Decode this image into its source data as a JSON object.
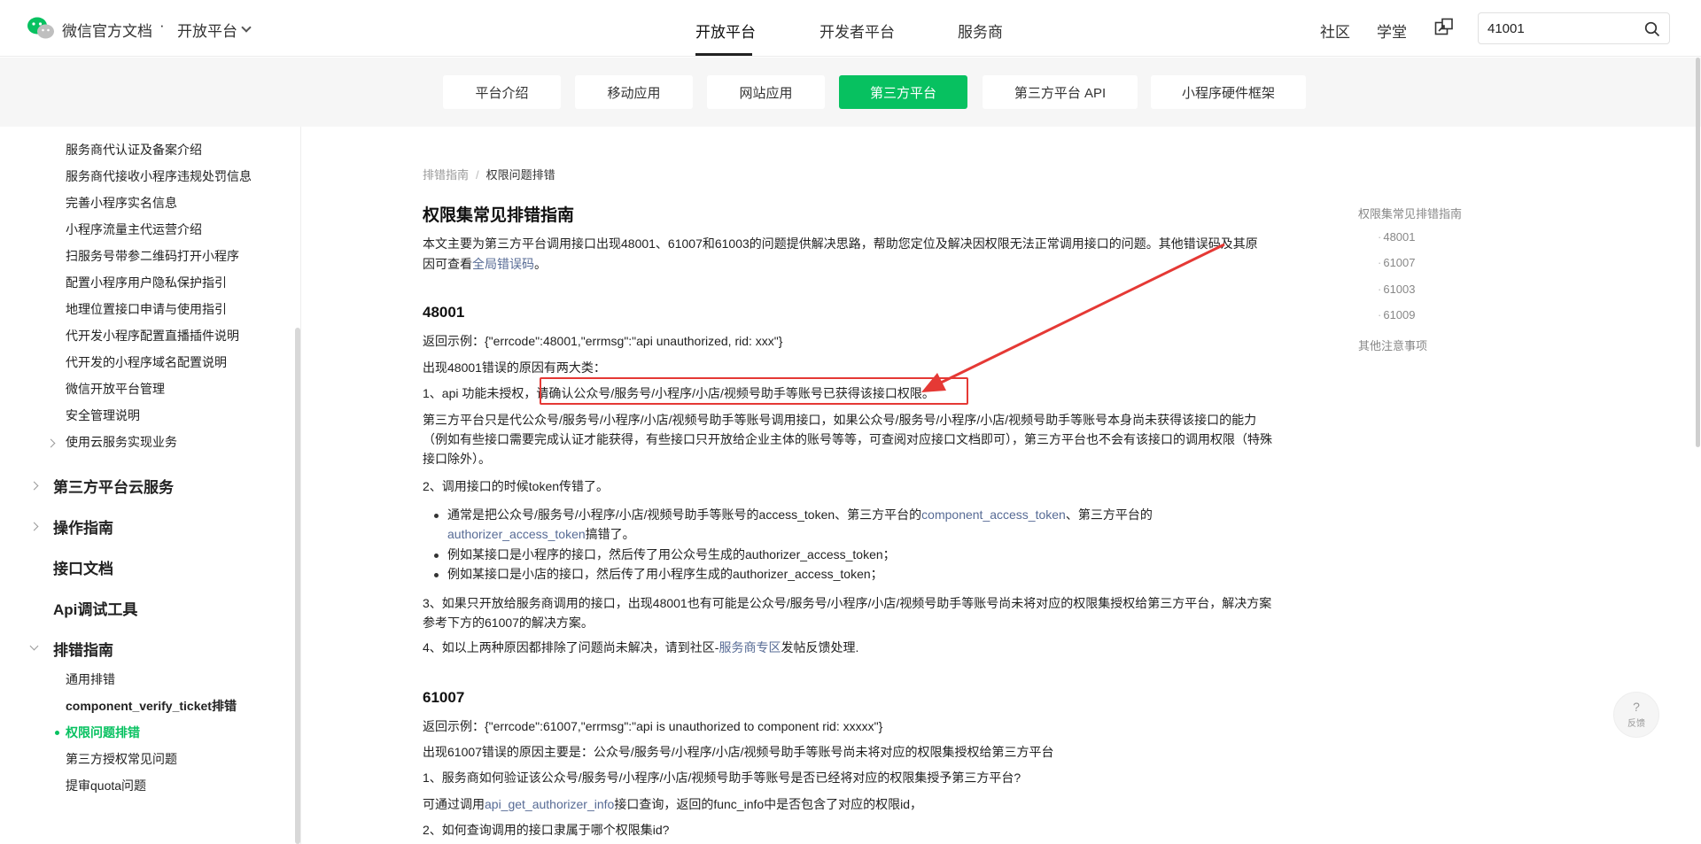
{
  "header": {
    "brand": "微信官方文档",
    "brand_dot": "·",
    "platform": "开放平台",
    "nav": [
      "开放平台",
      "开发者平台",
      "服务商"
    ],
    "right_links": [
      "社区",
      "学堂"
    ],
    "search_value": "41001"
  },
  "subnav": [
    "平台介绍",
    "移动应用",
    "网站应用",
    "第三方平台",
    "第三方平台 API",
    "小程序硬件框架"
  ],
  "sidebar": {
    "sub_items_top": [
      "服务商代认证及备案介绍",
      "服务商代接收小程序违规处罚信息",
      "完善小程序实名信息",
      "小程序流量主代运营介绍",
      "扫服务号带参二维码打开小程序",
      "配置小程序用户隐私保护指引",
      "地理位置接口申请与使用指引",
      "代开发小程序配置直播插件说明",
      "代开发的小程序域名配置说明",
      "微信开放平台管理",
      "安全管理说明",
      "使用云服务实现业务"
    ],
    "top_items": [
      "第三方平台云服务",
      "操作指南",
      "接口文档",
      "Api调试工具",
      "排错指南"
    ],
    "sub_items_bottom": [
      "通用排错",
      "component_verify_ticket排错",
      "权限问题排错",
      "第三方授权常见问题",
      "提审quota问题"
    ]
  },
  "content": {
    "breadcrumb": [
      "排错指南",
      "/",
      "权限问题排错"
    ],
    "title": "权限集常见排错指南",
    "intro_1": "本文主要为第三方平台调用接口出现48001、61007和61003的问题提供解决思路，帮助您定位及解决因权限无法正常调用接口的问题。其他错误码及其原",
    "intro_2a": "因可查看",
    "intro_link": "全局错误码",
    "intro_2b": "。",
    "s48001": {
      "heading": "48001",
      "example": "返回示例：{\"errcode\":48001,\"errmsg\":\"api unauthorized, rid: xxx\"}",
      "reasons": "出现48001错误的原因有两大类：",
      "r1a": "1、api 功能未授权，",
      "r1b": "请确认公众号/服务号/小程序/小店/视频号助手等账号已获得该接口权限。",
      "p1": "第三方平台只是代公众号/服务号/小程序/小店/视频号助手等账号调用接口，如果公众号/服务号/小程序/小店/视频号助手等账号本身尚未获得该接口的能力（例如有些接口需要完成认证才能获得，有些接口只开放给企业主体的账号等等，可查阅对应接口文档即可），第三方平台也不会有该接口的调用权限（特殊接口除外）。",
      "r2": "2、调用接口的时候token传错了。",
      "b1a": "通常是把公众号/服务号/小程序/小店/视频号助手等账号的access_token、第三方平台的",
      "b1link1": "component_access_token",
      "b1b": "、第三方平台的",
      "b1link2": "authorizer_access_token",
      "b1c": "搞错了。",
      "b2": "例如某接口是小程序的接口，然后传了用公众号生成的authorizer_access_token；",
      "b3": "例如某接口是小店的接口，然后传了用小程序生成的authorizer_access_token；",
      "r3": "3、如果只开放给服务商调用的接口，出现48001也有可能是公众号/服务号/小程序/小店/视频号助手等账号尚未将对应的权限集授权给第三方平台，解决方案参考下方的61007的解决方案。",
      "r4a": "4、如以上两种原因都排除了问题尚未解决，请到社区-",
      "r4link": "服务商专区",
      "r4b": "发帖反馈处理."
    },
    "s61007": {
      "heading": "61007",
      "example": "返回示例：{\"errcode\":61007,\"errmsg\":\"api is unauthorized to component rid: xxxxx\"}",
      "reasons": "出现61007错误的原因主要是：公众号/服务号/小程序/小店/视频号助手等账号尚未将对应的权限集授权给第三方平台",
      "q1": "1、服务商如何验证该公众号/服务号/小程序/小店/视频号助手等账号是否已经将对应的权限集授予第三方平台?",
      "a1a": "可通过调用",
      "a1link": "api_get_authorizer_info",
      "a1b": "接口查询，返回的func_info中是否包含了对应的权限id，",
      "q2": "2、如何查询调用的接口隶属于哪个权限集id?"
    }
  },
  "toc": {
    "title": "权限集常见排错指南",
    "items": [
      "48001",
      "61007",
      "61003",
      "61009"
    ],
    "dot": "·",
    "other": "其他注意事项"
  },
  "feedback": {
    "symbol": "?",
    "label": "反馈"
  },
  "colors": {
    "accent": "#07c160",
    "link": "#576b95",
    "annotation": "#e53935"
  }
}
